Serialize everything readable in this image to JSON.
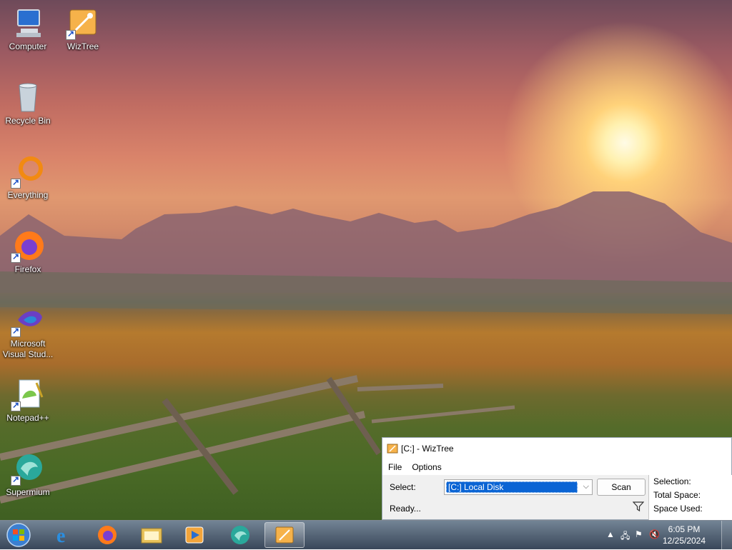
{
  "desktop": {
    "icons": [
      {
        "label": "Computer"
      },
      {
        "label": "WizTree"
      },
      {
        "label": "Recycle Bin"
      },
      {
        "label": "Everything"
      },
      {
        "label": "Firefox"
      },
      {
        "label": "Microsoft Visual Stud..."
      },
      {
        "label": "Notepad++"
      },
      {
        "label": "Supermium"
      }
    ]
  },
  "wiztree": {
    "title": "[C:]  - WizTree",
    "menu": {
      "file": "File",
      "options": "Options"
    },
    "select_label": "Select:",
    "drive_value": "[C:] Local Disk",
    "scan_label": "Scan",
    "status": "Ready...",
    "info": {
      "selection": "Selection:",
      "total_space": "Total Space:",
      "space_used": "Space Used:"
    }
  },
  "taskbar": {
    "pinned": [
      "internet-explorer",
      "firefox",
      "file-explorer",
      "media-player",
      "supermium",
      "wiztree"
    ],
    "clock": {
      "time": "6:05 PM",
      "date": "12/25/2024"
    }
  }
}
